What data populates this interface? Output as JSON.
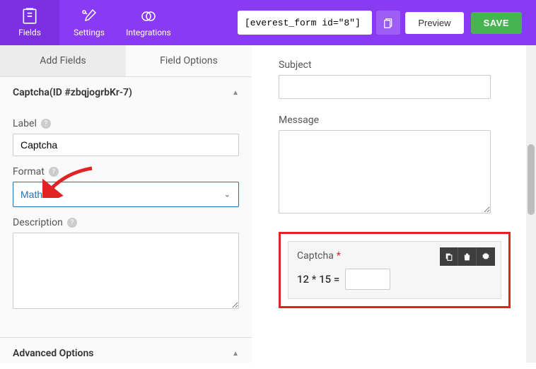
{
  "nav": {
    "fields": "Fields",
    "settings": "Settings",
    "integrations": "Integrations"
  },
  "shortcode": "[everest_form id=\"8\"]",
  "buttons": {
    "preview": "Preview",
    "save": "SAVE"
  },
  "sideTabs": {
    "add": "Add Fields",
    "options": "Field Options"
  },
  "panel": {
    "title": "Captcha(ID #zbqjogrbKr-7)",
    "labelLabel": "Label",
    "labelValue": "Captcha",
    "formatLabel": "Format",
    "formatValue": "Math",
    "descriptionLabel": "Description",
    "descriptionValue": "",
    "advanced": "Advanced Options"
  },
  "preview": {
    "subject": "Subject",
    "message": "Message",
    "captchaLabel": "Captcha",
    "mathExpr": "12 * 15 ="
  }
}
